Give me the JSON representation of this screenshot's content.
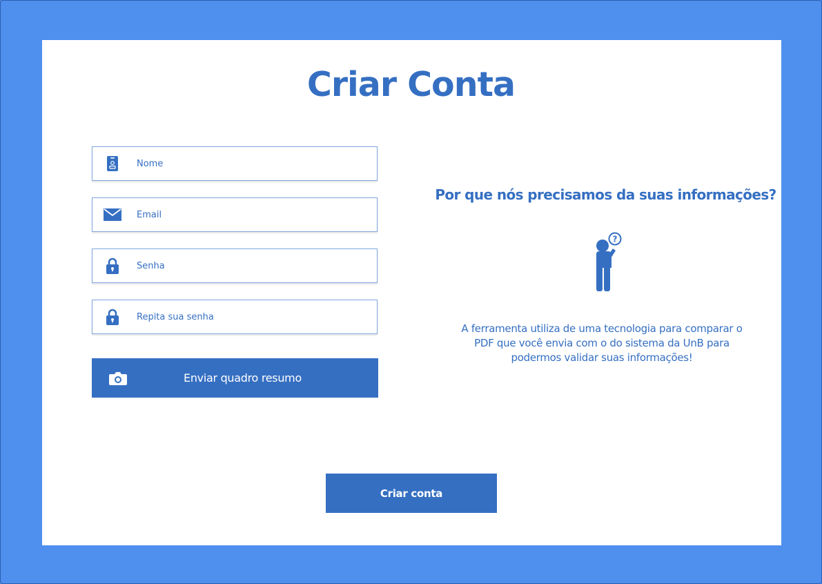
{
  "page": {
    "title": "Criar Conta"
  },
  "form": {
    "fields": [
      {
        "name": "nome",
        "placeholder": "Nome",
        "value": "",
        "icon": "id-badge-icon"
      },
      {
        "name": "email",
        "placeholder": "Email",
        "value": "",
        "icon": "envelope-icon"
      },
      {
        "name": "senha",
        "placeholder": "Senha",
        "value": "",
        "icon": "lock-icon"
      },
      {
        "name": "repita-senha",
        "placeholder": "Repita sua senha",
        "value": "",
        "icon": "lock-icon"
      }
    ],
    "upload_button": {
      "label": "Enviar quadro resumo",
      "icon": "camera-icon"
    },
    "submit_button": {
      "label": "Criar conta"
    }
  },
  "info": {
    "heading": "Por que nós precisamos da suas informações?",
    "illustration": "person-question-icon",
    "text": "A ferramenta utiliza de uma tecnologia para comparar o PDF que você envia com o do sistema da UnB para podermos validar suas informações!"
  },
  "colors": {
    "background": "#4f8fee",
    "card": "#ffffff",
    "accent": "#356fc2",
    "field_border": "#7ea6de"
  }
}
